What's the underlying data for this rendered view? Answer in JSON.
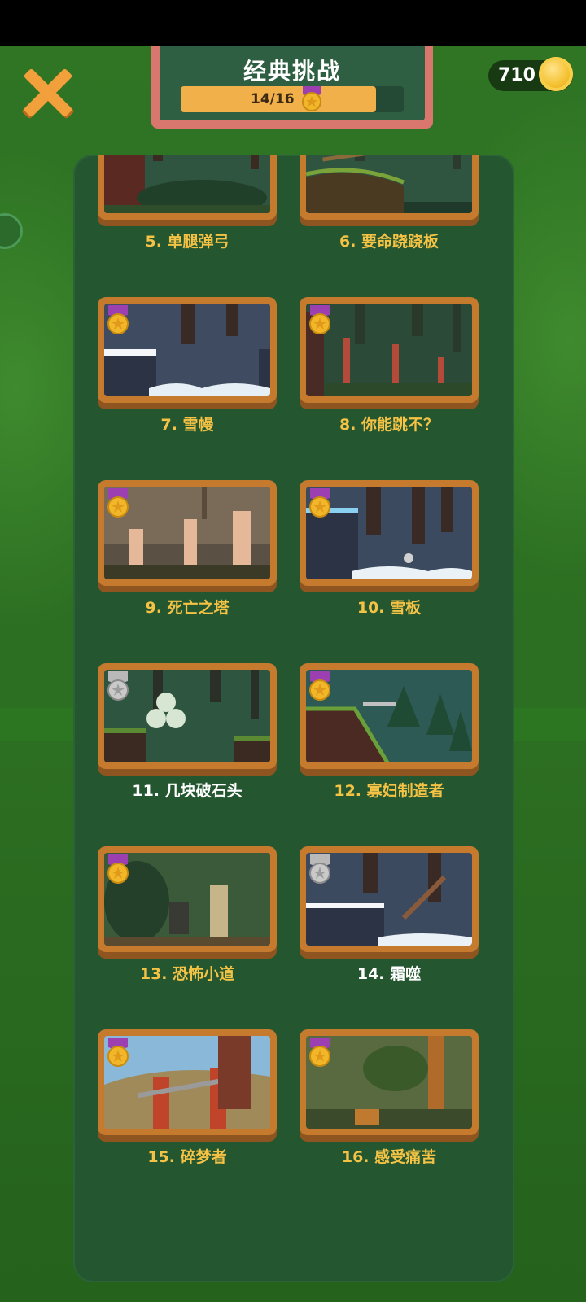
{
  "header": {
    "title": "经典挑战",
    "progress_text": "14/16",
    "progress_fraction": 0.875
  },
  "coins": {
    "amount": "710"
  },
  "colors": {
    "label_gold": "#f4c245",
    "label_white": "#ffffff",
    "panel": "#245630",
    "frame": "#c67a2e"
  },
  "levels": [
    {
      "label": "5. 单腿弹弓",
      "medal": "gold",
      "label_color": "gold",
      "scene": "forest"
    },
    {
      "label": "6. 要命跷跷板",
      "medal": "gold",
      "label_color": "gold",
      "scene": "forest-plank"
    },
    {
      "label": "7. 雪幔",
      "medal": "gold",
      "label_color": "gold",
      "scene": "snow"
    },
    {
      "label": "8. 你能跳不？",
      "medal": "gold",
      "label_color": "gold",
      "scene": "forest-posts"
    },
    {
      "label": "9. 死亡之塔",
      "medal": "gold",
      "label_color": "gold",
      "scene": "towers"
    },
    {
      "label": "10. 雪板",
      "medal": "gold",
      "label_color": "gold",
      "scene": "snow-night"
    },
    {
      "label": "11. 几块破石头",
      "medal": "locked",
      "label_color": "white",
      "scene": "rocks"
    },
    {
      "label": "12. 寡妇制造者",
      "medal": "gold",
      "label_color": "gold",
      "scene": "pine-slope"
    },
    {
      "label": "13. 恐怖小道",
      "medal": "gold",
      "label_color": "gold",
      "scene": "jungle-ruins"
    },
    {
      "label": "14. 霜噬",
      "medal": "locked",
      "label_color": "white",
      "scene": "snow-crane"
    },
    {
      "label": "15. 碎梦者",
      "medal": "gold",
      "label_color": "gold",
      "scene": "scaffold"
    },
    {
      "label": "16. 感受痛苦",
      "medal": "gold",
      "label_color": "gold",
      "scene": "jungle-tower"
    }
  ]
}
